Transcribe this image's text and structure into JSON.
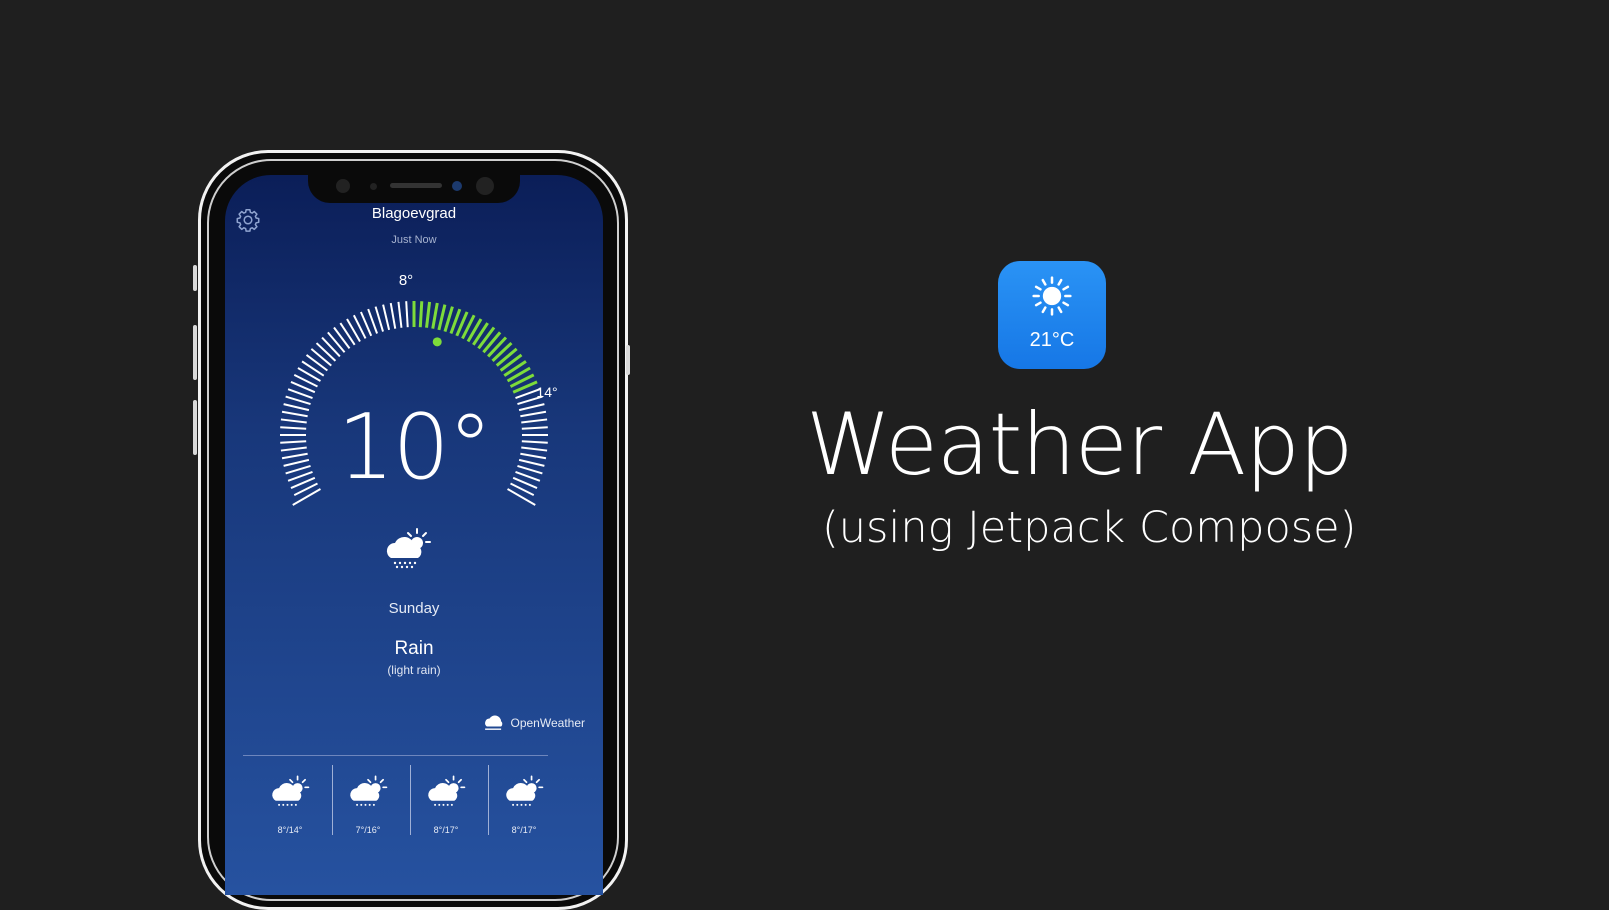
{
  "app": {
    "city": "Blagoevgrad",
    "updated": "Just Now",
    "gauge": {
      "min_label": "8°",
      "max_label": "14°",
      "current": "10°"
    },
    "day": "Sunday",
    "condition": "Rain",
    "condition_detail": "(light rain)",
    "provider": "OpenWeather",
    "forecast": [
      {
        "temp": "8°/14°"
      },
      {
        "temp": "7°/16°"
      },
      {
        "temp": "8°/17°"
      },
      {
        "temp": "8°/17°"
      }
    ],
    "colors": {
      "gauge_active": "#7ddc3a",
      "gauge_tick": "#ffffff",
      "screen_top": "#0b1e58",
      "screen_bottom": "#2652a0"
    }
  },
  "promo": {
    "icon_temp": "21°C",
    "title": "Weather App",
    "subtitle": "(using Jetpack Compose)",
    "icon_color": "#1f86ee"
  }
}
